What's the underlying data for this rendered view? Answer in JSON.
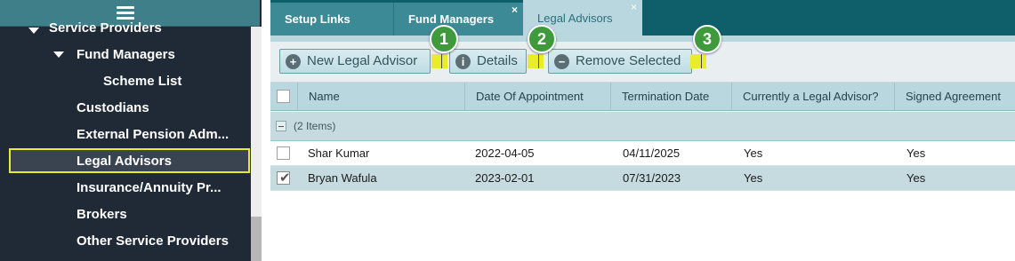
{
  "sidebar": {
    "items": [
      {
        "label": "Service Providers"
      },
      {
        "label": "Fund Managers"
      },
      {
        "label": "Scheme List"
      },
      {
        "label": "Custodians"
      },
      {
        "label": "External Pension Adm..."
      },
      {
        "label": "Legal Advisors"
      },
      {
        "label": "Insurance/Annuity Pr..."
      },
      {
        "label": "Brokers"
      },
      {
        "label": "Other Service Providers"
      }
    ]
  },
  "tabs": [
    {
      "label": "Setup Links"
    },
    {
      "label": "Fund Managers",
      "close": "×"
    },
    {
      "label": "Legal Advisors",
      "close": "×"
    }
  ],
  "toolbar": {
    "new_label": "New Legal Advisor",
    "details_label": "Details",
    "remove_label": "Remove Selected",
    "new_icon": "+",
    "details_icon": "i",
    "remove_icon": "−"
  },
  "badges": [
    "1",
    "2",
    "3"
  ],
  "grid": {
    "columns": [
      "Name",
      "Date Of Appointment",
      "Termination Date",
      "Currently a Legal Advisor?",
      "Signed Agreement"
    ],
    "group_label": "(2 Items)",
    "rows": [
      {
        "name": "Shar Kumar",
        "appointment": "2022-04-05",
        "termination": "04/11/2025",
        "current": "Yes",
        "signed": "Yes",
        "checked": false
      },
      {
        "name": "Bryan Wafula",
        "appointment": "2023-02-01",
        "termination": "07/31/2023",
        "current": "Yes",
        "signed": "Yes",
        "checked": true
      }
    ]
  },
  "colors": {
    "sidebar_bg": "#1f2a36",
    "tab_active_bg": "#b9d7de",
    "highlight": "#e8ec2a",
    "badge_green": "#3e9a3a"
  }
}
